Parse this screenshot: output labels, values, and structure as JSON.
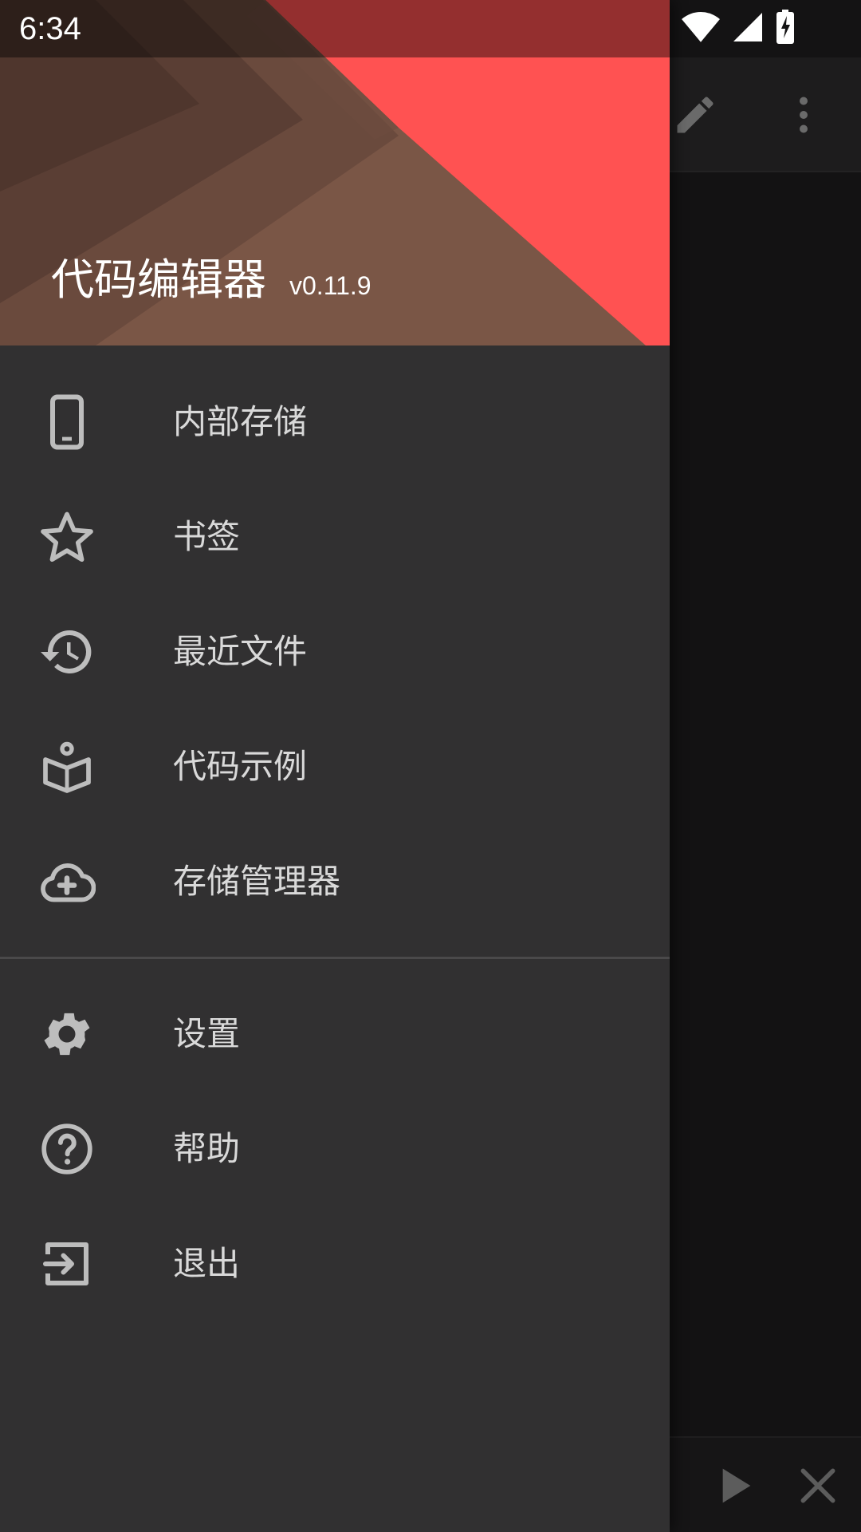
{
  "status_bar": {
    "time": "6:34"
  },
  "drawer": {
    "title": "代码编辑器",
    "version": "v0.11.9",
    "primary_items": [
      {
        "label": "内部存储",
        "icon": "phone-icon"
      },
      {
        "label": "书签",
        "icon": "star-icon"
      },
      {
        "label": "最近文件",
        "icon": "history-icon"
      },
      {
        "label": "代码示例",
        "icon": "book-icon"
      },
      {
        "label": "存储管理器",
        "icon": "cloud-add-icon"
      }
    ],
    "secondary_items": [
      {
        "label": "设置",
        "icon": "gear-icon"
      },
      {
        "label": "帮助",
        "icon": "help-icon"
      },
      {
        "label": "退出",
        "icon": "exit-icon"
      }
    ]
  },
  "colors": {
    "drawer_bg": "#313031",
    "header_brown": "#7a5646",
    "header_red": "#ff5252",
    "icon_gray": "#bdbdbd",
    "text_light": "#d9d9d9"
  }
}
